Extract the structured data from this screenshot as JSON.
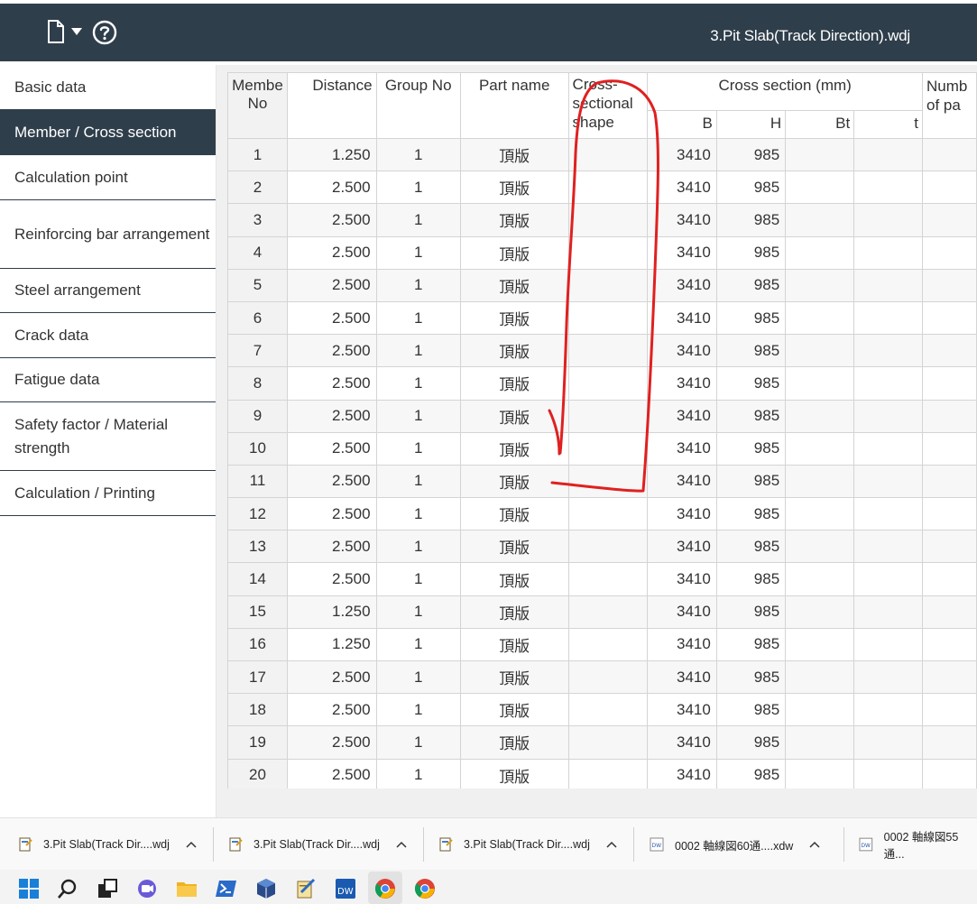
{
  "header": {
    "title": "3.Pit Slab(Track Direction).wdj",
    "icons": [
      "file-icon",
      "chevron-down-icon",
      "help-icon"
    ]
  },
  "sidebar": {
    "items": [
      {
        "label": "Basic data",
        "active": false
      },
      {
        "label": "Member / Cross section",
        "active": true
      },
      {
        "label": "Calculation point",
        "active": false
      },
      {
        "label": "Reinforcing bar arrangement",
        "active": false
      },
      {
        "label": "Steel arrangement",
        "active": false
      },
      {
        "label": "Crack data",
        "active": false
      },
      {
        "label": "Fatigue data",
        "active": false
      },
      {
        "label": "Safety factor / Material strength",
        "active": false
      },
      {
        "label": "Calculation / Printing",
        "active": false
      }
    ]
  },
  "table": {
    "headers": {
      "member_no": "Membe No",
      "distance": "Distance",
      "group_no": "Group No",
      "part_name": "Part name",
      "shape": "Cross-sectional shape",
      "cross_section": "Cross section (mm)",
      "b": "B",
      "h": "H",
      "bt": "Bt",
      "t": "t",
      "number": "Numb of pa"
    },
    "rows": [
      {
        "no": "1",
        "distance": "1.250",
        "group": "1",
        "part": "頂版",
        "shape": "",
        "b": "3410",
        "h": "985",
        "bt": "",
        "t": ""
      },
      {
        "no": "2",
        "distance": "2.500",
        "group": "1",
        "part": "頂版",
        "shape": "",
        "b": "3410",
        "h": "985",
        "bt": "",
        "t": ""
      },
      {
        "no": "3",
        "distance": "2.500",
        "group": "1",
        "part": "頂版",
        "shape": "",
        "b": "3410",
        "h": "985",
        "bt": "",
        "t": ""
      },
      {
        "no": "4",
        "distance": "2.500",
        "group": "1",
        "part": "頂版",
        "shape": "",
        "b": "3410",
        "h": "985",
        "bt": "",
        "t": ""
      },
      {
        "no": "5",
        "distance": "2.500",
        "group": "1",
        "part": "頂版",
        "shape": "",
        "b": "3410",
        "h": "985",
        "bt": "",
        "t": ""
      },
      {
        "no": "6",
        "distance": "2.500",
        "group": "1",
        "part": "頂版",
        "shape": "",
        "b": "3410",
        "h": "985",
        "bt": "",
        "t": ""
      },
      {
        "no": "7",
        "distance": "2.500",
        "group": "1",
        "part": "頂版",
        "shape": "",
        "b": "3410",
        "h": "985",
        "bt": "",
        "t": ""
      },
      {
        "no": "8",
        "distance": "2.500",
        "group": "1",
        "part": "頂版",
        "shape": "",
        "b": "3410",
        "h": "985",
        "bt": "",
        "t": ""
      },
      {
        "no": "9",
        "distance": "2.500",
        "group": "1",
        "part": "頂版",
        "shape": "",
        "b": "3410",
        "h": "985",
        "bt": "",
        "t": ""
      },
      {
        "no": "10",
        "distance": "2.500",
        "group": "1",
        "part": "頂版",
        "shape": "",
        "b": "3410",
        "h": "985",
        "bt": "",
        "t": ""
      },
      {
        "no": "11",
        "distance": "2.500",
        "group": "1",
        "part": "頂版",
        "shape": "",
        "b": "3410",
        "h": "985",
        "bt": "",
        "t": ""
      },
      {
        "no": "12",
        "distance": "2.500",
        "group": "1",
        "part": "頂版",
        "shape": "",
        "b": "3410",
        "h": "985",
        "bt": "",
        "t": ""
      },
      {
        "no": "13",
        "distance": "2.500",
        "group": "1",
        "part": "頂版",
        "shape": "",
        "b": "3410",
        "h": "985",
        "bt": "",
        "t": ""
      },
      {
        "no": "14",
        "distance": "2.500",
        "group": "1",
        "part": "頂版",
        "shape": "",
        "b": "3410",
        "h": "985",
        "bt": "",
        "t": ""
      },
      {
        "no": "15",
        "distance": "1.250",
        "group": "1",
        "part": "頂版",
        "shape": "",
        "b": "3410",
        "h": "985",
        "bt": "",
        "t": ""
      },
      {
        "no": "16",
        "distance": "1.250",
        "group": "1",
        "part": "頂版",
        "shape": "",
        "b": "3410",
        "h": "985",
        "bt": "",
        "t": ""
      },
      {
        "no": "17",
        "distance": "2.500",
        "group": "1",
        "part": "頂版",
        "shape": "",
        "b": "3410",
        "h": "985",
        "bt": "",
        "t": ""
      },
      {
        "no": "18",
        "distance": "2.500",
        "group": "1",
        "part": "頂版",
        "shape": "",
        "b": "3410",
        "h": "985",
        "bt": "",
        "t": ""
      },
      {
        "no": "19",
        "distance": "2.500",
        "group": "1",
        "part": "頂版",
        "shape": "",
        "b": "3410",
        "h": "985",
        "bt": "",
        "t": ""
      },
      {
        "no": "20",
        "distance": "2.500",
        "group": "1",
        "part": "頂版",
        "shape": "",
        "b": "3410",
        "h": "985",
        "bt": "",
        "t": ""
      }
    ]
  },
  "annotation": {
    "color": "#e02020"
  },
  "docs_bar": {
    "items": [
      {
        "label": "3.Pit Slab(Track Dir....wdj",
        "icon": "wdj-file-icon"
      },
      {
        "label": "3.Pit Slab(Track Dir....wdj",
        "icon": "wdj-file-icon"
      },
      {
        "label": "3.Pit Slab(Track Dir....wdj",
        "icon": "wdj-file-icon"
      },
      {
        "label": "0002 軸線図60通....xdw",
        "icon": "docuworks-file-icon"
      },
      {
        "label": "0002 軸線図55通...",
        "icon": "docuworks-file-icon"
      }
    ]
  },
  "taskbar": {
    "icons": [
      "windows-start-icon",
      "search-icon",
      "task-view-icon",
      "chat-icon",
      "file-explorer-icon",
      "powershell-icon",
      "virtualbox-icon",
      "notepad-app-icon",
      "docuworks-icon",
      "chrome-icon",
      "chrome-icon"
    ]
  }
}
